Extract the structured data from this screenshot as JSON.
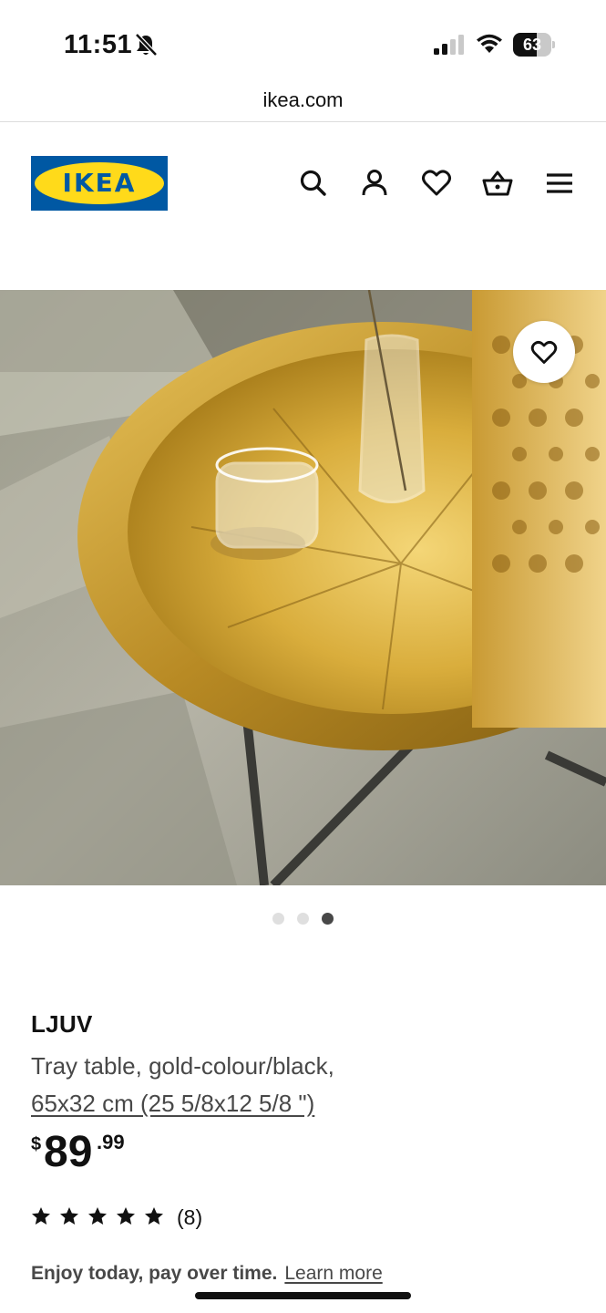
{
  "status_bar": {
    "time": "11:51",
    "battery": "63",
    "battery_level": 0.63,
    "icons": [
      "bell-slash-icon",
      "cellular-signal-icon",
      "wifi-icon",
      "battery-icon"
    ]
  },
  "url_bar": {
    "domain": "ikea.com"
  },
  "header": {
    "logo_text": "IKEA",
    "icons": [
      "search-icon",
      "account-icon",
      "heart-icon",
      "basket-icon",
      "menu-icon"
    ]
  },
  "gallery": {
    "image_count": 3,
    "active_index": 2,
    "favourite_icon": "heart-icon"
  },
  "product": {
    "name": "LJUV",
    "description": "Tray table, gold-colour/black,",
    "size": "65x32 cm (25 5/8x12 5/8 \")",
    "price": {
      "currency": "$",
      "integer": "89",
      "decimal": ".99"
    },
    "rating": {
      "stars": 5,
      "max_stars": 5,
      "count": "(8)"
    }
  },
  "promo": {
    "text": "Enjoy today, pay over time.",
    "link": "Learn more"
  },
  "colors": {
    "ikea_blue": "#0058a3",
    "ikea_yellow": "#ffda1a",
    "text_primary": "#111111",
    "text_secondary": "#484848"
  }
}
